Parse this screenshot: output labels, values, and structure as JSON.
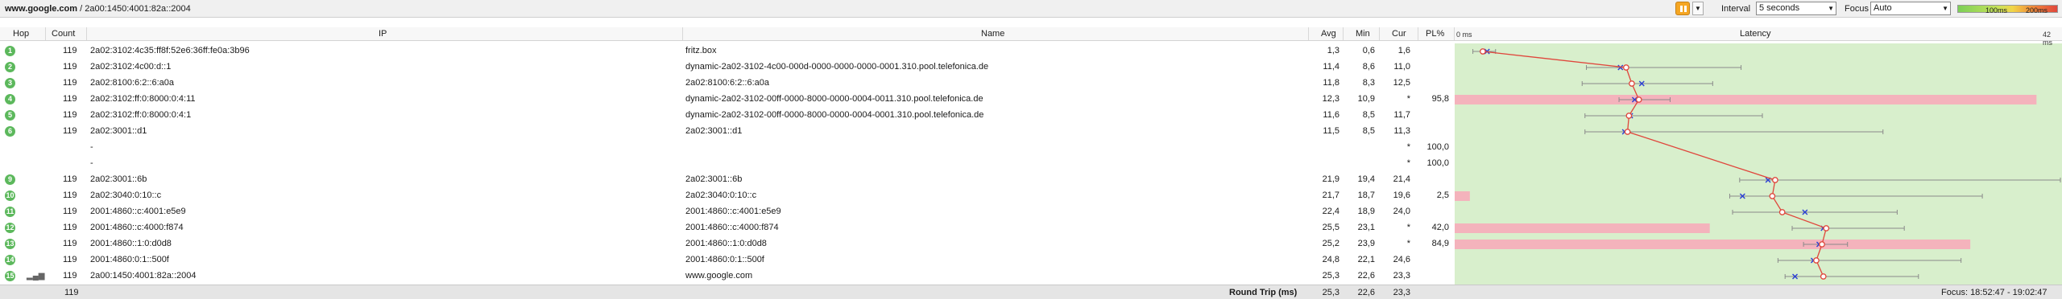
{
  "toolbar": {
    "host": "www.google.com",
    "address": " / 2a00:1450:4001:82a::2004",
    "interval_label": "Interval",
    "interval_value": "5 seconds",
    "focus_label": "Focus",
    "focus_value": "Auto",
    "legend_low": "100ms",
    "legend_high": "200ms",
    "pause_icon": "pause-icon"
  },
  "columns": {
    "hop": "Hop",
    "count": "Count",
    "ip": "IP",
    "name": "Name",
    "avg": "Avg",
    "min": "Min",
    "cur": "Cur",
    "pl": "PL%",
    "latency": "Latency"
  },
  "latency_scale": {
    "min_label": "0 ms",
    "max_label": "42 ms",
    "max_ms": 42
  },
  "rows": [
    {
      "hop": "1",
      "count": "119",
      "ip": "2a02:3102:4c35:ff8f:52e6:36ff:fe0a:3b96",
      "name": "fritz.box",
      "avg": "1,3",
      "min": "0,6",
      "cur": "1,6",
      "pl": "",
      "pl_value": 0,
      "min_v": 0.6,
      "avg_v": 1.3,
      "cur_v": 1.6,
      "max_v": 2.2
    },
    {
      "hop": "2",
      "count": "119",
      "ip": "2a02:3102:4c00:d::1",
      "name": "dynamic-2a02-3102-4c00-000d-0000-0000-0000-0001.310.pool.telefonica.de",
      "avg": "11,4",
      "min": "8,6",
      "cur": "11,0",
      "pl": "",
      "pl_value": 0,
      "min_v": 8.6,
      "avg_v": 11.4,
      "cur_v": 11.0,
      "max_v": 19.5
    },
    {
      "hop": "3",
      "count": "119",
      "ip": "2a02:8100:6:2::6:a0a",
      "name": "2a02:8100:6:2::6:a0a",
      "avg": "11,8",
      "min": "8,3",
      "cur": "12,5",
      "pl": "",
      "pl_value": 0,
      "min_v": 8.3,
      "avg_v": 11.8,
      "cur_v": 12.5,
      "max_v": 17.5
    },
    {
      "hop": "4",
      "count": "119",
      "ip": "2a02:3102:ff:0:8000:0:4:11",
      "name": "dynamic-2a02-3102-00ff-0000-8000-0000-0004-0011.310.pool.telefonica.de",
      "avg": "12,3",
      "min": "10,9",
      "cur": "*",
      "pl": "95,8",
      "pl_value": 95.8,
      "min_v": 10.9,
      "avg_v": 12.3,
      "cur_v": 12.0,
      "max_v": 14.5
    },
    {
      "hop": "5",
      "count": "119",
      "ip": "2a02:3102:ff:0:8000:0:4:1",
      "name": "dynamic-2a02-3102-00ff-0000-8000-0000-0004-0001.310.pool.telefonica.de",
      "avg": "11,6",
      "min": "8,5",
      "cur": "11,7",
      "pl": "",
      "pl_value": 0,
      "min_v": 8.5,
      "avg_v": 11.6,
      "cur_v": 11.7,
      "max_v": 21.0
    },
    {
      "hop": "6",
      "count": "119",
      "ip": "2a02:3001::d1",
      "name": "2a02:3001::d1",
      "avg": "11,5",
      "min": "8,5",
      "cur": "11,3",
      "pl": "",
      "pl_value": 0,
      "min_v": 8.5,
      "avg_v": 11.5,
      "cur_v": 11.3,
      "max_v": 29.5
    },
    {
      "hop": "",
      "count": "",
      "ip": "-",
      "name": "",
      "avg": "",
      "min": "",
      "cur": "*",
      "pl": "100,0",
      "pl_value": 0,
      "min_v": null,
      "avg_v": null,
      "cur_v": null,
      "max_v": null
    },
    {
      "hop": "",
      "count": "",
      "ip": "-",
      "name": "",
      "avg": "",
      "min": "",
      "cur": "*",
      "pl": "100,0",
      "pl_value": 0,
      "min_v": null,
      "avg_v": null,
      "cur_v": null,
      "max_v": null
    },
    {
      "hop": "9",
      "count": "119",
      "ip": "2a02:3001::6b",
      "name": "2a02:3001::6b",
      "avg": "21,9",
      "min": "19,4",
      "cur": "21,4",
      "pl": "",
      "pl_value": 0,
      "min_v": 19.4,
      "avg_v": 21.9,
      "cur_v": 21.4,
      "max_v": 42.0
    },
    {
      "hop": "10",
      "count": "119",
      "ip": "2a02:3040:0:10::c",
      "name": "2a02:3040:0:10::c",
      "avg": "21,7",
      "min": "18,7",
      "cur": "19,6",
      "pl": "2,5",
      "pl_value": 2.5,
      "min_v": 18.7,
      "avg_v": 21.7,
      "cur_v": 19.6,
      "max_v": 36.5
    },
    {
      "hop": "11",
      "count": "119",
      "ip": "2001:4860::c:4001:e5e9",
      "name": "2001:4860::c:4001:e5e9",
      "avg": "22,4",
      "min": "18,9",
      "cur": "24,0",
      "pl": "",
      "pl_value": 0,
      "min_v": 18.9,
      "avg_v": 22.4,
      "cur_v": 24.0,
      "max_v": 30.5
    },
    {
      "hop": "12",
      "count": "119",
      "ip": "2001:4860::c:4000:f874",
      "name": "2001:4860::c:4000:f874",
      "avg": "25,5",
      "min": "23,1",
      "cur": "*",
      "pl": "42,0",
      "pl_value": 42.0,
      "min_v": 23.1,
      "avg_v": 25.5,
      "cur_v": 25.3,
      "max_v": 31.0
    },
    {
      "hop": "13",
      "count": "119",
      "ip": "2001:4860::1:0:d0d8",
      "name": "2001:4860::1:0:d0d8",
      "avg": "25,2",
      "min": "23,9",
      "cur": "*",
      "pl": "84,9",
      "pl_value": 84.9,
      "min_v": 23.9,
      "avg_v": 25.2,
      "cur_v": 25.0,
      "max_v": 27.0
    },
    {
      "hop": "14",
      "count": "119",
      "ip": "2001:4860:0:1::500f",
      "name": "2001:4860:0:1::500f",
      "avg": "24,8",
      "min": "22,1",
      "cur": "24,6",
      "pl": "",
      "pl_value": 0,
      "min_v": 22.1,
      "avg_v": 24.8,
      "cur_v": 24.6,
      "max_v": 35.0
    },
    {
      "hop": "15",
      "count": "119",
      "ip": "2a00:1450:4001:82a::2004",
      "name": "www.google.com",
      "avg": "25,3",
      "min": "22,6",
      "cur": "23,3",
      "pl": "",
      "pl_value": 0,
      "min_v": 22.6,
      "avg_v": 25.3,
      "cur_v": 23.3,
      "max_v": 32.0
    }
  ],
  "footer": {
    "count": "119",
    "round_trip_label": "Round Trip (ms)",
    "avg": "25,3",
    "min": "22,6",
    "cur": "23,3",
    "focus_range": "Focus: 18:52:47 - 19:02:47"
  },
  "colors": {
    "latency_bg": "#d8efcc",
    "loss_bar": "#f4b3bc",
    "line": "#e0463c",
    "cur_marker": "#2b3fd6",
    "hop_badge": "#5cb85c"
  }
}
